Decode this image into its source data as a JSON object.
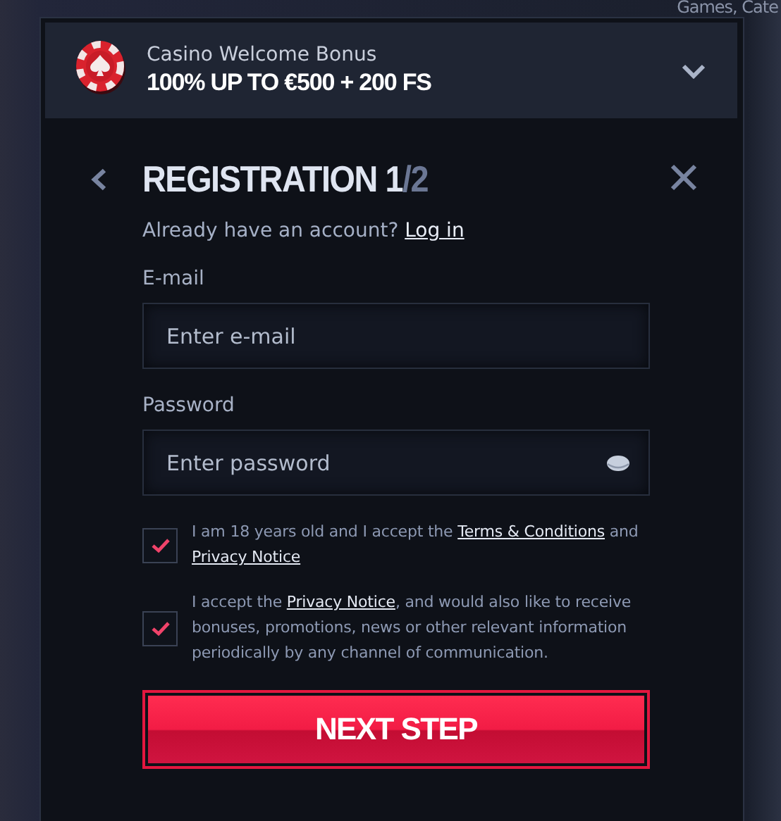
{
  "backdrop": {
    "search_text": "Games, Cate"
  },
  "bonus_banner": {
    "label": "Casino Welcome Bonus",
    "offer": "100% UP TO €500 + 200 FS",
    "expanded": false
  },
  "dialog": {
    "title": "REGISTRATION",
    "step": "1",
    "total": "/2"
  },
  "login_prompt": {
    "text": "Already have an account?",
    "link": "Log in"
  },
  "fields": [
    {
      "label": "E-mail",
      "placeholder": "Enter e-mail",
      "kind": "email"
    },
    {
      "label": "Password",
      "placeholder": "Enter password",
      "kind": "password"
    }
  ],
  "consents": [
    {
      "checked": true,
      "parts": [
        {
          "text": "I am 18 years old and I accept the ",
          "link": false
        },
        {
          "text": "Terms & Conditions",
          "link": true
        },
        {
          "text": " and ",
          "link": false
        },
        {
          "text": "Privacy Notice",
          "link": true
        }
      ]
    },
    {
      "checked": true,
      "parts": [
        {
          "text": "I accept the ",
          "link": false
        },
        {
          "text": "Privacy Notice",
          "link": true
        },
        {
          "text": ", and would also like to receive bonuses, promotions, news or other relevant information periodically by any channel of communication.",
          "link": false
        }
      ]
    }
  ],
  "submit": "NEXT STEP"
}
